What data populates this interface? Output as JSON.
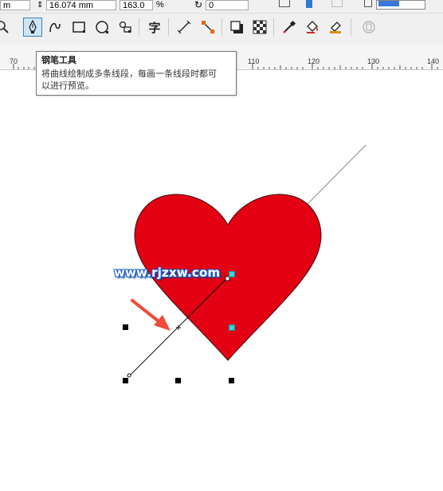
{
  "property_bar": {
    "width_field_value": "m",
    "height_field_value": "16.074 mm",
    "scale_field_value": "163.0",
    "scale_unit": "%",
    "rotation_field_value": "0"
  },
  "toolbox": {
    "tools": [
      {
        "name": "zoom-tool",
        "icon": "magnifier-icon"
      },
      {
        "name": "pen-tool",
        "icon": "pen-nib-icon",
        "active": true
      },
      {
        "name": "freehand-tool",
        "icon": "curve-icon"
      },
      {
        "name": "rectangle-tool",
        "icon": "square-icon"
      },
      {
        "name": "ellipse-tool",
        "icon": "circle-icon"
      },
      {
        "name": "polygon-tool",
        "icon": "shapes-icon"
      },
      {
        "name": "text-tool",
        "icon": "text-zi-icon"
      },
      {
        "name": "dimension-tool",
        "icon": "parallel-line-icon"
      },
      {
        "name": "connector-tool",
        "icon": "connector-icon"
      },
      {
        "name": "drop-shadow-tool",
        "icon": "shadow-square-icon"
      },
      {
        "name": "transparency-tool",
        "icon": "checker-icon"
      },
      {
        "name": "eyedropper-tool",
        "icon": "eyedropper-icon"
      },
      {
        "name": "interactive-fill-tool",
        "icon": "fill-bucket-icon"
      },
      {
        "name": "smart-fill-tool",
        "icon": "smart-fill-icon"
      },
      {
        "name": "lock-tool",
        "icon": "disabled-icon"
      }
    ],
    "text_tool_glyph": "字"
  },
  "ruler": {
    "labels": [
      "70",
      "110",
      "120",
      "130",
      "140"
    ]
  },
  "tooltip": {
    "title": "钢笔工具",
    "line1": "将曲线绘制成多条线段，每画一条线段时都可",
    "line2": "以进行预览。"
  },
  "canvas": {
    "watermark_text": "www.rjzxw.com",
    "heart_fill_color": "#e30013",
    "node_color": "#2bd9d9",
    "arrow_color": "#f04a3a"
  }
}
